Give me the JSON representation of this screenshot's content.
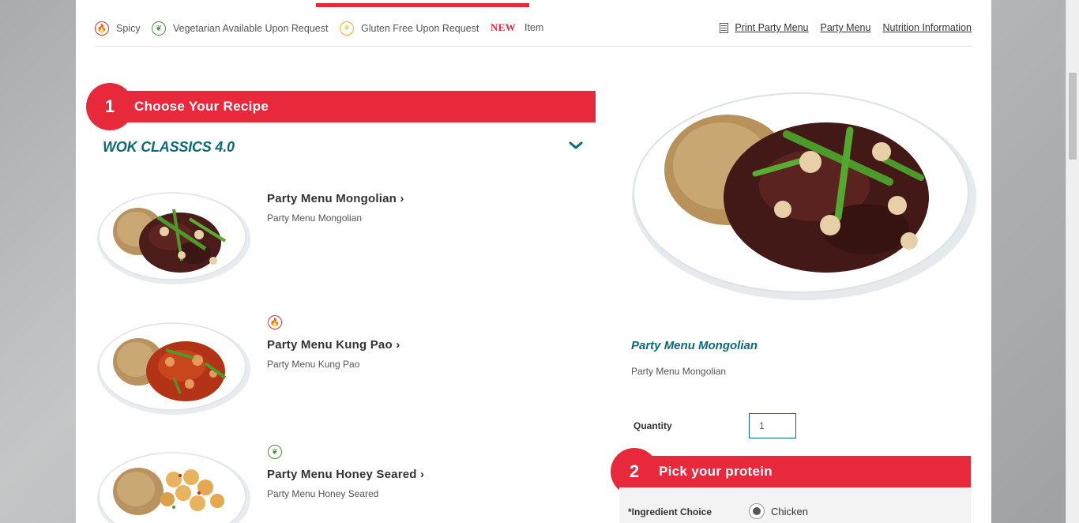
{
  "legend": {
    "spicy_label": "Spicy",
    "vegetarian_label": "Vegetarian Available Upon Request",
    "gluten_free_label": "Gluten Free Upon Request",
    "new_badge": "NEW",
    "new_label": "Item",
    "links": {
      "print": "Print Party Menu",
      "party_menu": "Party Menu",
      "nutrition": "Nutrition Information"
    }
  },
  "step1": {
    "number": "1",
    "title": "Choose Your Recipe"
  },
  "category": {
    "title": "WOK CLASSICS 4.0"
  },
  "items": [
    {
      "name": "Party Menu Mongolian",
      "arrow": "›",
      "desc": "Party Menu Mongolian",
      "badge": ""
    },
    {
      "name": "Party Menu Kung Pao",
      "arrow": "›",
      "desc": "Party Menu Kung Pao",
      "badge": "spicy-icon"
    },
    {
      "name": "Party Menu Honey Seared",
      "arrow": "›",
      "desc": "Party Menu Honey Seared",
      "badge": "vegetarian-icon"
    }
  ],
  "selected": {
    "name": "Party Menu Mongolian",
    "desc": "Party Menu Mongolian",
    "quantity_label": "Quantity",
    "quantity_value": "1"
  },
  "step2": {
    "number": "2",
    "title": "Pick your protein"
  },
  "ingredient": {
    "label": "*Ingredient Choice",
    "value": "Chicken"
  },
  "colors": {
    "brand_red": "#e8283b",
    "teal": "#0b6a7a"
  }
}
